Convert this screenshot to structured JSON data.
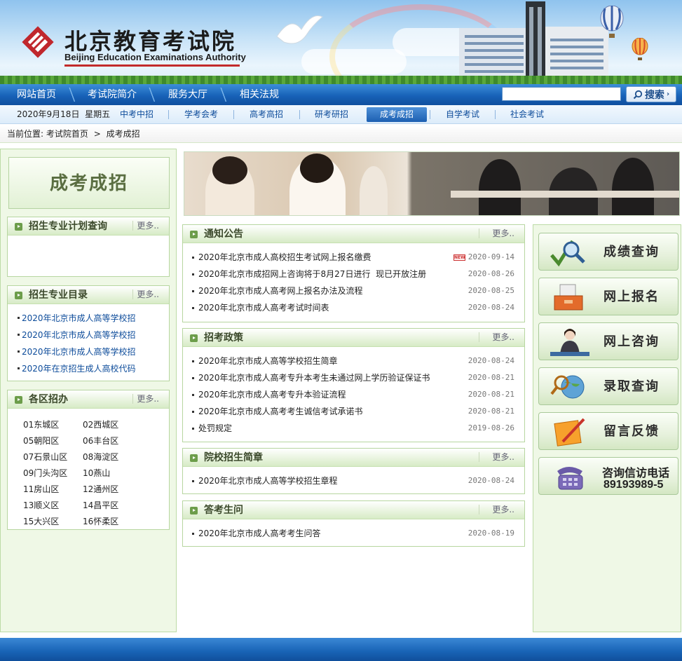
{
  "header": {
    "logo_cn": "北京教育考试院",
    "logo_en": "Beijing Education Examinations Authority"
  },
  "main_nav": [
    "网站首页",
    "考试院简介",
    "服务大厅",
    "相关法规"
  ],
  "search": {
    "placeholder": "",
    "button_label": "搜索"
  },
  "sub_nav": {
    "date": "2020年9月18日  星期五",
    "items": [
      "中考中招",
      "学考会考",
      "高考高招",
      "研考研招",
      "成考成招",
      "自学考试",
      "社会考试"
    ],
    "active": "成考成招"
  },
  "breadcrumb": {
    "prefix": "当前位置:",
    "home": "考试院首页",
    "separator": ">",
    "current": "成考成招"
  },
  "left": {
    "badge": "成考成招",
    "more": "更多..",
    "plan_title": "招生专业计划查询",
    "catalog_title": "招生专业目录",
    "catalog_items": [
      "2020年北京市成人高等学校招",
      "2020年北京市成人高等学校招",
      "2020年北京市成人高等学校招",
      "2020年在京招生成人高校代码"
    ],
    "district_title": "各区招办",
    "districts": [
      "01东城区",
      "02西城区",
      "05朝阳区",
      "06丰台区",
      "07石景山区",
      "08海淀区",
      "09门头沟区",
      "10燕山",
      "11房山区",
      "12通州区",
      "13顺义区",
      "14昌平区",
      "15大兴区",
      "16怀柔区"
    ]
  },
  "center": {
    "more": "更多..",
    "notice": {
      "title": "通知公告",
      "items": [
        {
          "text": "2020年北京市成人高校招生考试网上报名缴费",
          "date": "2020-09-14",
          "new": "NEW"
        },
        {
          "text": "2020年北京市成招网上咨询将于8月27日进行  现已开放注册",
          "date": "2020-08-26"
        },
        {
          "text": "2020年北京市成人高考网上报名办法及流程",
          "date": "2020-08-25"
        },
        {
          "text": "2020年北京市成人高考考试时间表",
          "date": "2020-08-24"
        }
      ]
    },
    "policy": {
      "title": "招考政策",
      "items": [
        {
          "text": "2020年北京市成人高等学校招生简章",
          "date": "2020-08-24"
        },
        {
          "text": "2020年北京市成人高考专升本考生未通过网上学历验证保证书",
          "date": "2020-08-21"
        },
        {
          "text": "2020年北京市成人高考专升本验证流程",
          "date": "2020-08-21"
        },
        {
          "text": "2020年北京市成人高考考生诚信考试承诺书",
          "date": "2020-08-21"
        },
        {
          "text": "处罚规定",
          "date": "2019-08-26"
        }
      ]
    },
    "brochure": {
      "title": "院校招生简章",
      "items": [
        {
          "text": "2020年北京市成人高等学校招生章程",
          "date": "2020-08-24"
        }
      ]
    },
    "qa": {
      "title": "答考生问",
      "items": [
        {
          "text": "2020年北京市成人高考考生问答",
          "date": "2020-08-19"
        }
      ]
    }
  },
  "right": {
    "links": [
      "成绩查询",
      "网上报名",
      "网上咨询",
      "录取查询",
      "留言反馈"
    ],
    "hotline_title": "咨询信访电话",
    "hotline_number": "89193989-5"
  }
}
